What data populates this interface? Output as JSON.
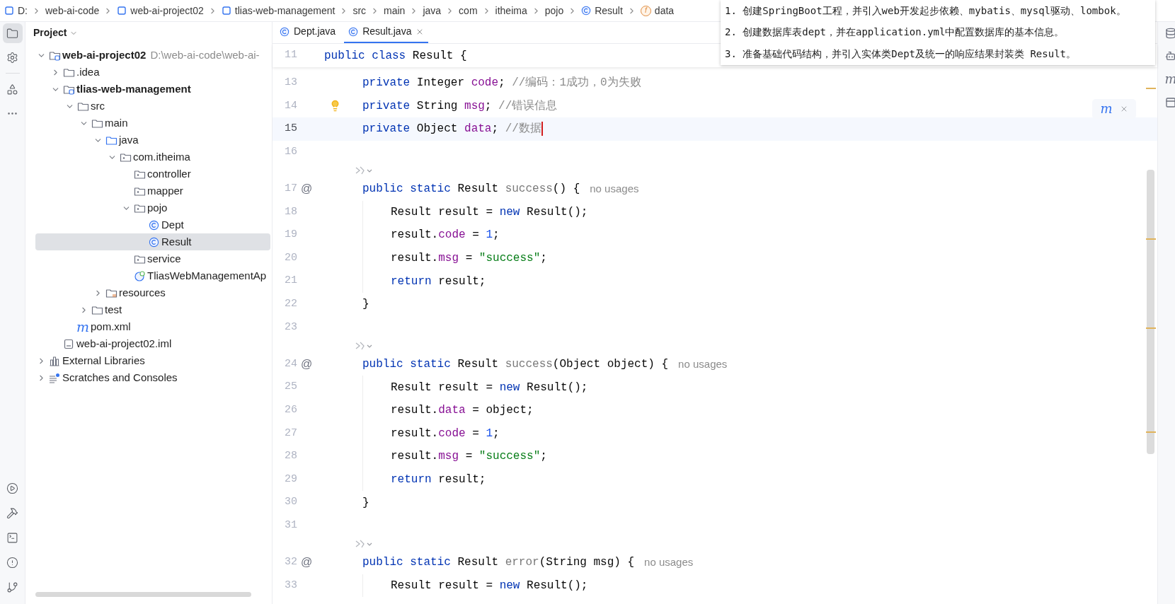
{
  "breadcrumbs": [
    {
      "label": "D:",
      "kind": "module"
    },
    {
      "label": "web-ai-code",
      "kind": "plain"
    },
    {
      "label": "web-ai-project02",
      "kind": "module"
    },
    {
      "label": "tlias-web-management",
      "kind": "module"
    },
    {
      "label": "src",
      "kind": "plain"
    },
    {
      "label": "main",
      "kind": "plain"
    },
    {
      "label": "java",
      "kind": "plain"
    },
    {
      "label": "com",
      "kind": "plain"
    },
    {
      "label": "itheima",
      "kind": "plain"
    },
    {
      "label": "pojo",
      "kind": "plain"
    },
    {
      "label": "Result",
      "kind": "class"
    },
    {
      "label": "data",
      "kind": "field",
      "glyph": "f"
    }
  ],
  "left_toolbar": {
    "top": [
      {
        "kind": "project",
        "selected": true
      },
      {
        "kind": "settings",
        "selected": false
      },
      {
        "kind": "structure",
        "selected": false
      },
      {
        "kind": "more",
        "selected": false
      }
    ],
    "bottom": [
      {
        "kind": "run"
      },
      {
        "kind": "build"
      },
      {
        "kind": "terminal"
      },
      {
        "kind": "problems"
      },
      {
        "kind": "git"
      }
    ]
  },
  "project_panel": {
    "title": "Project",
    "tree": [
      {
        "label": "web-ai-project02",
        "kind": "module",
        "path": "D:\\web-ai-code\\web-ai-",
        "expanded": true,
        "selected": false,
        "children": [
          {
            "label": ".idea",
            "kind": "folder",
            "expanded": false,
            "selected": false
          },
          {
            "label": "tlias-web-management",
            "kind": "module",
            "expanded": true,
            "selected": false,
            "children": [
              {
                "label": "src",
                "kind": "folder",
                "expanded": true,
                "selected": false,
                "children": [
                  {
                    "label": "main",
                    "kind": "folder",
                    "expanded": true,
                    "selected": false,
                    "children": [
                      {
                        "label": "java",
                        "kind": "source",
                        "expanded": true,
                        "selected": false,
                        "children": [
                          {
                            "label": "com.itheima",
                            "kind": "package",
                            "expanded": true,
                            "selected": false,
                            "children": [
                              {
                                "label": "controller",
                                "kind": "package",
                                "selected": false
                              },
                              {
                                "label": "mapper",
                                "kind": "package",
                                "selected": false
                              },
                              {
                                "label": "pojo",
                                "kind": "package",
                                "expanded": true,
                                "selected": false,
                                "children": [
                                  {
                                    "label": "Dept",
                                    "kind": "class",
                                    "selected": false
                                  },
                                  {
                                    "label": "Result",
                                    "kind": "class",
                                    "selected": true
                                  }
                                ]
                              },
                              {
                                "label": "service",
                                "kind": "package",
                                "selected": false
                              },
                              {
                                "label": "TliasWebManagementAp",
                                "kind": "app",
                                "selected": false
                              }
                            ]
                          }
                        ]
                      },
                      {
                        "label": "resources",
                        "kind": "resources",
                        "expanded": false,
                        "selected": false
                      }
                    ]
                  },
                  {
                    "label": "test",
                    "kind": "folder",
                    "expanded": false,
                    "selected": false
                  }
                ]
              },
              {
                "label": "pom.xml",
                "kind": "maven",
                "glyph": "m",
                "selected": false
              }
            ]
          },
          {
            "label": "web-ai-project02.iml",
            "kind": "file",
            "selected": false
          }
        ]
      },
      {
        "label": "External Libraries",
        "kind": "library",
        "expanded": false,
        "selected": false
      },
      {
        "label": "Scratches and Consoles",
        "kind": "scratches",
        "expanded": false,
        "selected": false
      }
    ]
  },
  "editor_tabs": [
    {
      "label": "Dept.java",
      "selected": false,
      "closable": false
    },
    {
      "label": "Result.java",
      "selected": true,
      "closable": true
    }
  ],
  "sticky_line": {
    "number": "11",
    "tokens": [
      {
        "t": "public class ",
        "kind": "keyword"
      },
      {
        "t": "Result {",
        "kind": "plain"
      }
    ]
  },
  "code_lines": [
    {
      "kind": "member",
      "number": "13",
      "current": false,
      "bulb": false,
      "tokens": [
        {
          "t": "private ",
          "kind": "keyword"
        },
        {
          "t": "Integer ",
          "kind": "plain"
        },
        {
          "t": "code",
          "kind": "field"
        },
        {
          "t": "; ",
          "kind": "plain"
        },
        {
          "t": "//编码：1成功，0为失败",
          "kind": "comment"
        }
      ]
    },
    {
      "kind": "member",
      "number": "14",
      "current": false,
      "bulb": true,
      "tokens": [
        {
          "t": "private ",
          "kind": "keyword"
        },
        {
          "t": "String ",
          "kind": "plain"
        },
        {
          "t": "msg",
          "kind": "field"
        },
        {
          "t": "; ",
          "kind": "plain"
        },
        {
          "t": "//错误信息",
          "kind": "comment"
        }
      ]
    },
    {
      "kind": "member",
      "number": "15",
      "current": true,
      "bulb": false,
      "tokens": [
        {
          "t": "private ",
          "kind": "keyword"
        },
        {
          "t": "Object ",
          "kind": "plain"
        },
        {
          "t": "data",
          "kind": "field"
        },
        {
          "t": "; ",
          "kind": "plain"
        },
        {
          "t": "//数据",
          "kind": "comment"
        }
      ]
    },
    {
      "kind": "blank",
      "number": "16",
      "current": false,
      "bulb": false
    },
    {
      "kind": "hint"
    },
    {
      "kind": "member",
      "number": "17",
      "current": false,
      "bulb": false,
      "gutter_mark": "@",
      "hint": "no usages",
      "tokens": [
        {
          "t": "public static ",
          "kind": "keyword"
        },
        {
          "t": "Result ",
          "kind": "plain"
        },
        {
          "t": "success",
          "kind": "unused"
        },
        {
          "t": "() {",
          "kind": "plain"
        }
      ]
    },
    {
      "kind": "body",
      "number": "18",
      "current": false,
      "bulb": false,
      "tokens": [
        {
          "t": "Result result = ",
          "kind": "plain"
        },
        {
          "t": "new ",
          "kind": "keyword"
        },
        {
          "t": "Result();",
          "kind": "plain"
        }
      ]
    },
    {
      "kind": "body",
      "number": "19",
      "current": false,
      "bulb": false,
      "tokens": [
        {
          "t": "result.",
          "kind": "plain"
        },
        {
          "t": "code",
          "kind": "field"
        },
        {
          "t": " = ",
          "kind": "plain"
        },
        {
          "t": "1",
          "kind": "number"
        },
        {
          "t": ";",
          "kind": "plain"
        }
      ]
    },
    {
      "kind": "body",
      "number": "20",
      "current": false,
      "bulb": false,
      "tokens": [
        {
          "t": "result.",
          "kind": "plain"
        },
        {
          "t": "msg",
          "kind": "field"
        },
        {
          "t": " = ",
          "kind": "plain"
        },
        {
          "t": "\"success\"",
          "kind": "string"
        },
        {
          "t": ";",
          "kind": "plain"
        }
      ]
    },
    {
      "kind": "body",
      "number": "21",
      "current": false,
      "bulb": false,
      "tokens": [
        {
          "t": "return ",
          "kind": "keyword"
        },
        {
          "t": "result;",
          "kind": "plain"
        }
      ]
    },
    {
      "kind": "member",
      "number": "22",
      "current": false,
      "bulb": false,
      "tokens": [
        {
          "t": "}",
          "kind": "plain"
        }
      ]
    },
    {
      "kind": "blank",
      "number": "23",
      "current": false,
      "bulb": false
    },
    {
      "kind": "hint"
    },
    {
      "kind": "member",
      "number": "24",
      "current": false,
      "bulb": false,
      "gutter_mark": "@",
      "hint": "no usages",
      "tokens": [
        {
          "t": "public static ",
          "kind": "keyword"
        },
        {
          "t": "Result ",
          "kind": "plain"
        },
        {
          "t": "success",
          "kind": "unused"
        },
        {
          "t": "(Object object) {",
          "kind": "plain"
        }
      ]
    },
    {
      "kind": "body",
      "number": "25",
      "current": false,
      "bulb": false,
      "tokens": [
        {
          "t": "Result result = ",
          "kind": "plain"
        },
        {
          "t": "new ",
          "kind": "keyword"
        },
        {
          "t": "Result();",
          "kind": "plain"
        }
      ]
    },
    {
      "kind": "body",
      "number": "26",
      "current": false,
      "bulb": false,
      "tokens": [
        {
          "t": "result.",
          "kind": "plain"
        },
        {
          "t": "data",
          "kind": "field"
        },
        {
          "t": " = object;",
          "kind": "plain"
        }
      ]
    },
    {
      "kind": "body",
      "number": "27",
      "current": false,
      "bulb": false,
      "tokens": [
        {
          "t": "result.",
          "kind": "plain"
        },
        {
          "t": "code",
          "kind": "field"
        },
        {
          "t": " = ",
          "kind": "plain"
        },
        {
          "t": "1",
          "kind": "number"
        },
        {
          "t": ";",
          "kind": "plain"
        }
      ]
    },
    {
      "kind": "body",
      "number": "28",
      "current": false,
      "bulb": false,
      "tokens": [
        {
          "t": "result.",
          "kind": "plain"
        },
        {
          "t": "msg",
          "kind": "field"
        },
        {
          "t": " = ",
          "kind": "plain"
        },
        {
          "t": "\"success\"",
          "kind": "string"
        },
        {
          "t": ";",
          "kind": "plain"
        }
      ]
    },
    {
      "kind": "body",
      "number": "29",
      "current": false,
      "bulb": false,
      "tokens": [
        {
          "t": "return ",
          "kind": "keyword"
        },
        {
          "t": "result;",
          "kind": "plain"
        }
      ]
    },
    {
      "kind": "member",
      "number": "30",
      "current": false,
      "bulb": false,
      "tokens": [
        {
          "t": "}",
          "kind": "plain"
        }
      ]
    },
    {
      "kind": "blank",
      "number": "31",
      "current": false,
      "bulb": false
    },
    {
      "kind": "hint"
    },
    {
      "kind": "member",
      "number": "32",
      "current": false,
      "bulb": false,
      "gutter_mark": "@",
      "hint": "no usages",
      "tokens": [
        {
          "t": "public static ",
          "kind": "keyword"
        },
        {
          "t": "Result ",
          "kind": "plain"
        },
        {
          "t": "error",
          "kind": "unused"
        },
        {
          "t": "(String msg) {",
          "kind": "plain"
        }
      ]
    },
    {
      "kind": "body",
      "number": "33",
      "current": false,
      "bulb": false,
      "tokens": [
        {
          "t": "Result result = ",
          "kind": "plain"
        },
        {
          "t": "new ",
          "kind": "keyword"
        },
        {
          "t": "Result();",
          "kind": "plain"
        }
      ]
    }
  ],
  "maven_popup": {
    "glyph": "m"
  },
  "right_toolbar": [
    {
      "kind": "database"
    },
    {
      "kind": "ai"
    },
    {
      "kind": "maven",
      "glyph": "m"
    },
    {
      "kind": "preview"
    }
  ],
  "notes": [
    "1. 创建SpringBoot工程，并引入web开发起步依赖、mybatis、mysql驱动、lombok。",
    "2. 创建数据库表dept，并在application.yml中配置数据库的基本信息。",
    "3. 准备基础代码结构，并引入实体类Dept及统一的响应结果封装类 Result。"
  ]
}
